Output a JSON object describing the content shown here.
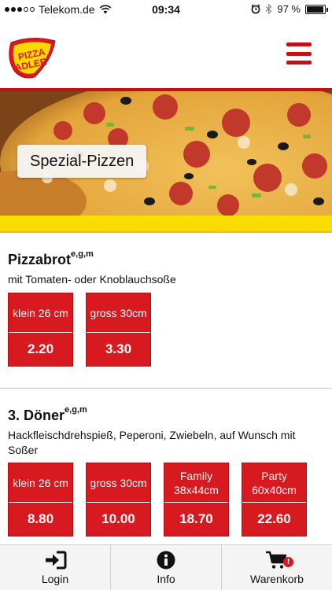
{
  "status_bar": {
    "carrier": "Telekom.de",
    "time": "09:34",
    "battery_text": "97 %",
    "battery_level": 0.97
  },
  "header": {
    "logo_text_line1": "PIZZA",
    "logo_text_line2": "ADLER",
    "menu_icon": "hamburger-menu-icon",
    "accent_color": "#c40f16"
  },
  "hero": {
    "category_label": "Spezial-Pizzen",
    "band_color": "#ffd800"
  },
  "products": [
    {
      "name": "Pizzabrot",
      "allergens": "e,g,m",
      "description": "mit Tomaten- oder Knoblauchsoße",
      "sizes": [
        {
          "label": "klein 26 cm",
          "price": "2.20"
        },
        {
          "label": "gross 30cm",
          "price": "3.30"
        }
      ]
    },
    {
      "name": "3. Döner",
      "allergens": "e,g,m",
      "description": "Hackfleischdrehspieß, Peperoni, Zwiebeln, auf Wunsch mit Soßer",
      "sizes": [
        {
          "label": "klein 26 cm",
          "price": "8.80"
        },
        {
          "label": "gross 30cm",
          "price": "10.00"
        },
        {
          "label": "Family 38x44cm",
          "price": "18.70"
        },
        {
          "label": "Party 60x40cm",
          "price": "22.60"
        }
      ]
    }
  ],
  "tabbar": {
    "login_label": "Login",
    "info_label": "Info",
    "cart_label": "Warenkorb",
    "cart_badge": "!",
    "login_icon": "login-icon",
    "info_icon": "info-icon",
    "cart_icon": "cart-icon"
  }
}
